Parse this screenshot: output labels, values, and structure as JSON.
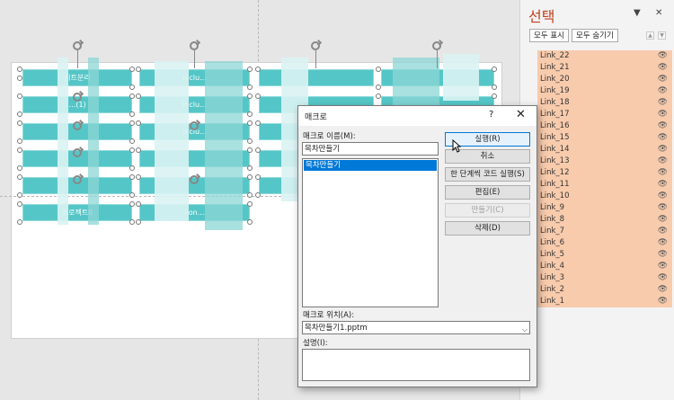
{
  "canvas": {
    "shape_labels": [
      "시트분리",
      "…(1)",
      "…",
      "…",
      "프로젝트0",
      "Inclu…",
      "Inclu…",
      "Inclu…",
      "con…",
      "…",
      "…",
      "…",
      "…",
      "…",
      "…",
      "…",
      "…",
      "…",
      "…",
      "…",
      "…",
      "…",
      "…",
      "…"
    ]
  },
  "selection_pane": {
    "title": "선택",
    "show_all": "모두 표시",
    "hide_all": "모두 숨기기",
    "items": [
      "Link_22",
      "Link_21",
      "Link_20",
      "Link_19",
      "Link_18",
      "Link_17",
      "Link_16",
      "Link_15",
      "Link_14",
      "Link_13",
      "Link_12",
      "Link_11",
      "Link_10",
      "Link_9",
      "Link_8",
      "Link_7",
      "Link_6",
      "Link_5",
      "Link_4",
      "Link_3",
      "Link_2",
      "Link_1"
    ],
    "highlight_color": "#f8cbad",
    "title_color": "#c43e1c",
    "icons": {
      "dropdown": "chevron-down-icon",
      "close": "close-icon",
      "eye": "eye-icon",
      "up": "move-up-icon",
      "down": "move-down-icon"
    }
  },
  "dialog": {
    "title": "매크로",
    "help": "?",
    "close": "✕",
    "name_label": "매크로 이름(M):",
    "name_value": "목차만들기",
    "macros": [
      "목차만들기"
    ],
    "buttons": {
      "run": "실행(R)",
      "cancel": "취소",
      "step": "한 단계씩 코드 실행(S)",
      "edit": "편집(E)",
      "create": "만들기(C)",
      "delete": "삭제(D)"
    },
    "location_label": "매크로 위치(A):",
    "location_value": "목차만들기1.pptm",
    "description_label": "설명(I):",
    "description_value": "",
    "accent": "#0078d7"
  }
}
